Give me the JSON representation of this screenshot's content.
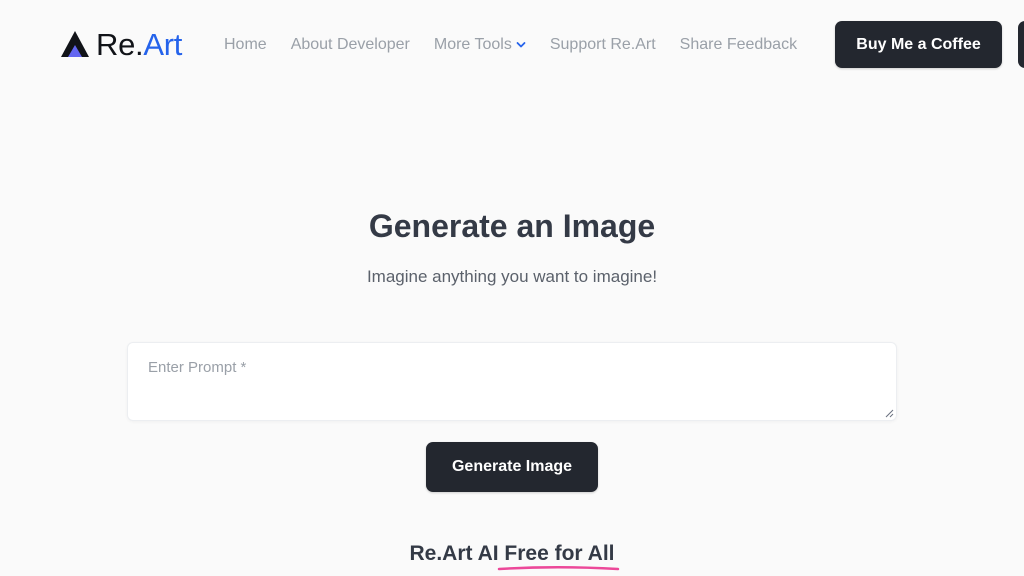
{
  "logo": {
    "name_part1": "Re.",
    "name_part2": "Art",
    "mark_color": "#111318",
    "mark_accent": "#6366f1",
    "accent_color": "#2563eb"
  },
  "nav": {
    "items": [
      {
        "label": "Home"
      },
      {
        "label": "About Developer"
      },
      {
        "label": "More Tools",
        "icon": "chevron-down-icon"
      },
      {
        "label": "Support Re.Art"
      },
      {
        "label": "Share Feedback"
      }
    ],
    "cta_label": "Buy Me a Coffee"
  },
  "hero": {
    "title": "Generate an Image",
    "subtitle": "Imagine anything you want to imagine!"
  },
  "prompt": {
    "placeholder": "Enter Prompt *",
    "value": ""
  },
  "generate_button": "Generate Image",
  "tagline": {
    "part1": "Re.Art AI ",
    "highlight": "Free for All",
    "underline_color": "#ec4899"
  },
  "colors": {
    "dark_button": "#23272f",
    "nav_text": "#9aa0a8",
    "chevron": "#2563eb"
  }
}
